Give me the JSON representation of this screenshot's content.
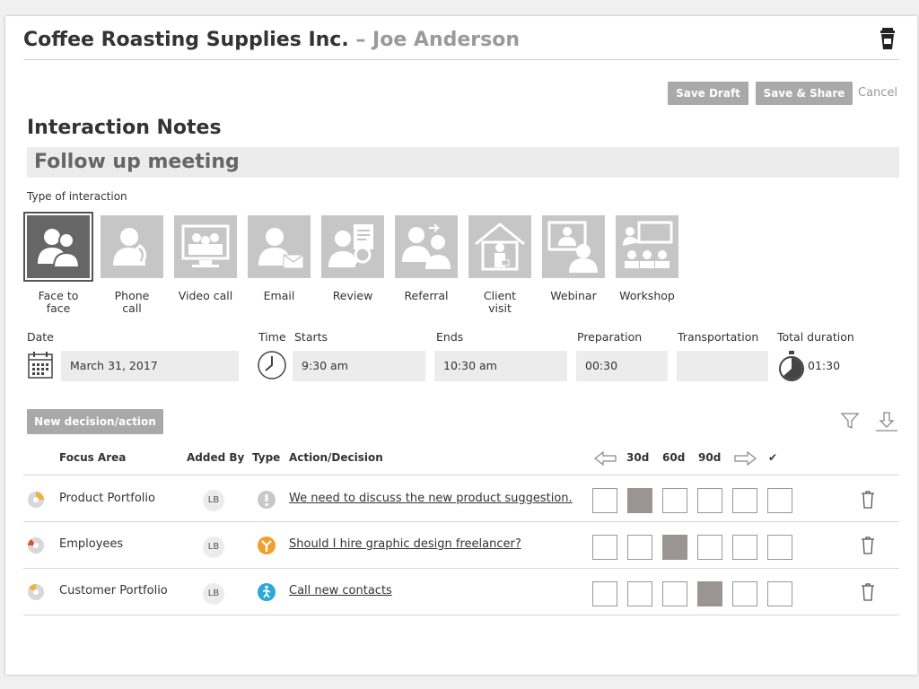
{
  "header": {
    "company": "Coffee Roasting Supplies Inc.",
    "separator": " – ",
    "contact": "Joe Anderson"
  },
  "buttons": {
    "save_draft": "Save Draft",
    "save_share": "Save & Share",
    "cancel": "Cancel",
    "new_decision": "New decision/action"
  },
  "form": {
    "heading": "Interaction Notes",
    "title_value": "Follow up meeting",
    "type_label": "Type of interaction",
    "types": [
      {
        "line1": "Face to",
        "line2": "face",
        "icon": "face-to-face-icon",
        "selected": true
      },
      {
        "line1": "Phone",
        "line2": "call",
        "icon": "phone-call-icon",
        "selected": false
      },
      {
        "line1": "Video call",
        "line2": "",
        "icon": "video-call-icon",
        "selected": false
      },
      {
        "line1": "Email",
        "line2": "",
        "icon": "email-icon",
        "selected": false
      },
      {
        "line1": "Review",
        "line2": "",
        "icon": "review-icon",
        "selected": false
      },
      {
        "line1": "Referral",
        "line2": "",
        "icon": "referral-icon",
        "selected": false
      },
      {
        "line1": "Client",
        "line2": "visit",
        "icon": "client-visit-icon",
        "selected": false
      },
      {
        "line1": "Webinar",
        "line2": "",
        "icon": "webinar-icon",
        "selected": false
      },
      {
        "line1": "Workshop",
        "line2": "",
        "icon": "workshop-icon",
        "selected": false
      }
    ],
    "date_label": "Date",
    "date_value": "March 31, 2017",
    "time_label": "Time",
    "starts_label": "Starts",
    "starts_value": "9:30 am",
    "ends_label": "Ends",
    "ends_value": "10:30 am",
    "prep_label": "Preparation",
    "prep_value": "00:30",
    "transport_label": "Transportation",
    "transport_value": "",
    "total_label": "Total duration",
    "total_value": "01:30"
  },
  "table": {
    "headers": {
      "focus": "Focus Area",
      "added_by": "Added By",
      "type": "Type",
      "action": "Action/Decision",
      "d30": "30d",
      "d60": "60d",
      "d90": "90d",
      "done": "✔"
    },
    "rows": [
      {
        "focus": "Product Portfolio",
        "added_by": "LB",
        "type_icon": "exclamation-icon",
        "action": "We need to discuss the new product suggestion.",
        "filled_index": 1
      },
      {
        "focus": "Employees",
        "added_by": "LB",
        "type_icon": "decision-branch-icon",
        "action": "Should I hire graphic design freelancer?",
        "filled_index": 2
      },
      {
        "focus": "Customer Portfolio",
        "added_by": "LB",
        "type_icon": "walking-person-icon",
        "action": "Call new contacts",
        "filled_index": 3
      }
    ]
  },
  "colors": {
    "button_gray": "#a9a9a9",
    "field_gray": "#ececec",
    "selected_type": "#666666",
    "filled_square": "#9a9492",
    "orange": "#f0a030",
    "blue": "#2aa8d8"
  }
}
